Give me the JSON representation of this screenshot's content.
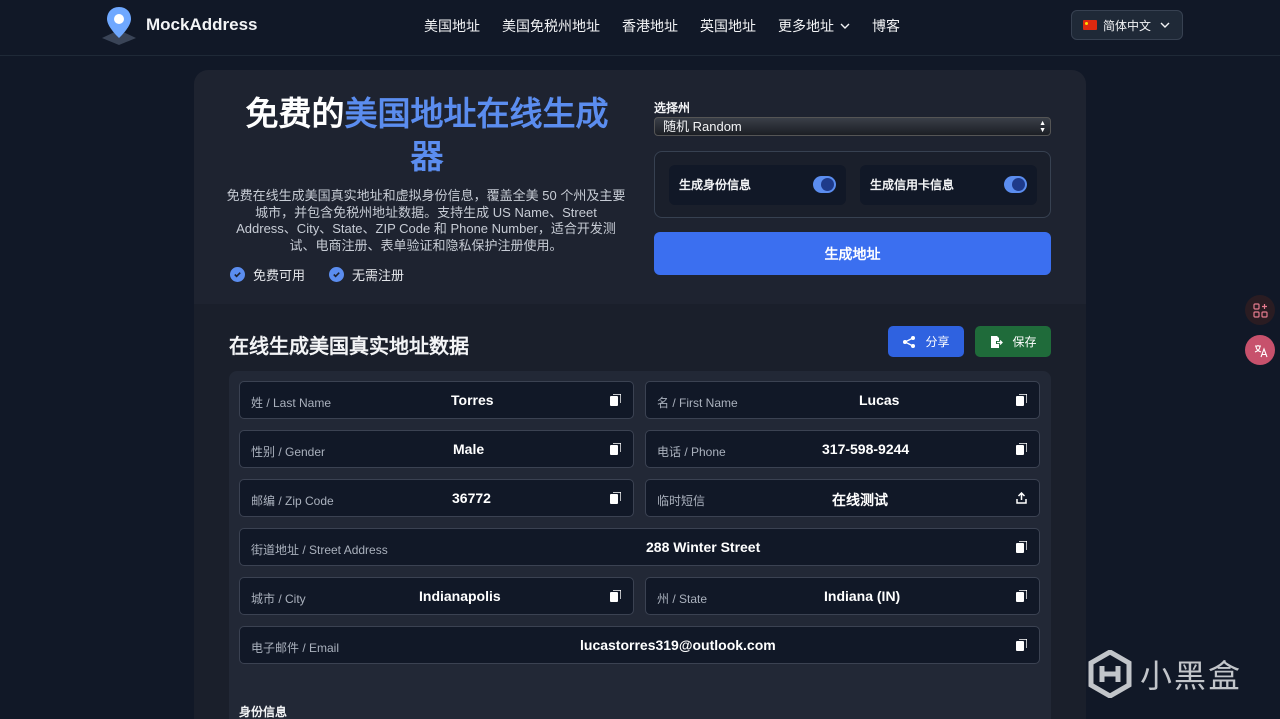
{
  "header": {
    "brand": "MockAddress",
    "nav": [
      "美国地址",
      "美国免税州地址",
      "香港地址",
      "英国地址",
      "更多地址",
      "博客"
    ],
    "language": "简体中文"
  },
  "hero": {
    "title_prefix": "免费的",
    "title_highlight": "美国地址在线生成",
    "title_suffix": "器",
    "description": "免费在线生成美国真实地址和虚拟身份信息，覆盖全美 50 个州及主要城市，并包含免税州地址数据。支持生成 US Name、Street Address、City、State、ZIP Code 和 Phone Number，适合开发测试、电商注册、表单验证和隐私保护注册使用。",
    "badges": [
      "免费可用",
      "无需注册"
    ],
    "state_label": "选择州",
    "state_value": "随机 Random",
    "toggle_identity": "生成身份信息",
    "toggle_card": "生成信用卡信息",
    "generate_button": "生成地址"
  },
  "results": {
    "title": "在线生成美国真实地址数据",
    "share_label": "分享",
    "save_label": "保存",
    "fields": {
      "last_name": {
        "label": "姓 / Last Name",
        "value": "Torres"
      },
      "first_name": {
        "label": "名 / First Name",
        "value": "Lucas"
      },
      "gender": {
        "label": "性别 / Gender",
        "value": "Male"
      },
      "phone": {
        "label": "电话 / Phone",
        "value": "317-598-9244"
      },
      "zip": {
        "label": "邮编 / Zip Code",
        "value": "36772"
      },
      "sms": {
        "label": "临时短信",
        "value": "在线测试"
      },
      "street": {
        "label": "街道地址 / Street Address",
        "value": "288 Winter Street"
      },
      "city": {
        "label": "城市 / City",
        "value": "Indianapolis"
      },
      "state": {
        "label": "州 / State",
        "value": "Indiana (IN)"
      },
      "email": {
        "label": "电子邮件 / Email",
        "value": "lucastorres319@outlook.com"
      }
    },
    "identity_title": "身份信息"
  },
  "watermark": "小黑盒",
  "colors": {
    "accent": "#3b6ff0",
    "highlight": "#5b8def",
    "save": "#1f6b3a",
    "background": "#111827"
  }
}
